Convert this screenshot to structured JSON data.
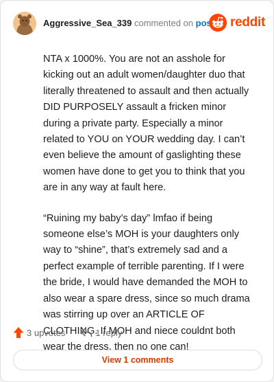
{
  "header": {
    "username": "Aggressive_Sea_339",
    "action_text": "commented on",
    "post_link": "post",
    "brand": "reddit",
    "colors": {
      "brand": "#ff4500",
      "link": "#0079d3",
      "button_text": "#d93a00"
    }
  },
  "comment": {
    "paragraphs": [
      "NTA x 1000%. You are not an asshole for kicking out an adult women/daughter duo that literally threatened to assault and then actually DID PURPOSELY assault a fricken minor during a private party. Especially a minor related to YOU on YOUR wedding day. I can’t even believe the amount of gaslighting these women have done to get you to think that you are in any way at fault here.",
      "“Ruining my baby’s day” lmfao if being someone else’s MOH is your daughters only way to “shine”, that’s extremely sad and a perfect example of terrible parenting. If I were the bride, I would have demanded the MOH to also wear a spare dress, since so much drama was stirring up over an ARTICLE OF CLOTHING. If MOH and niece couldnt both wear the dress, then no one can!"
    ]
  },
  "footer": {
    "upvotes_label": "3 upvotes",
    "reply_label": "1 reply",
    "view_comments_label": "View 1 comments",
    "icons": {
      "upvote": "upvote-arrow-icon",
      "reply": "reply-arrow-icon"
    }
  }
}
